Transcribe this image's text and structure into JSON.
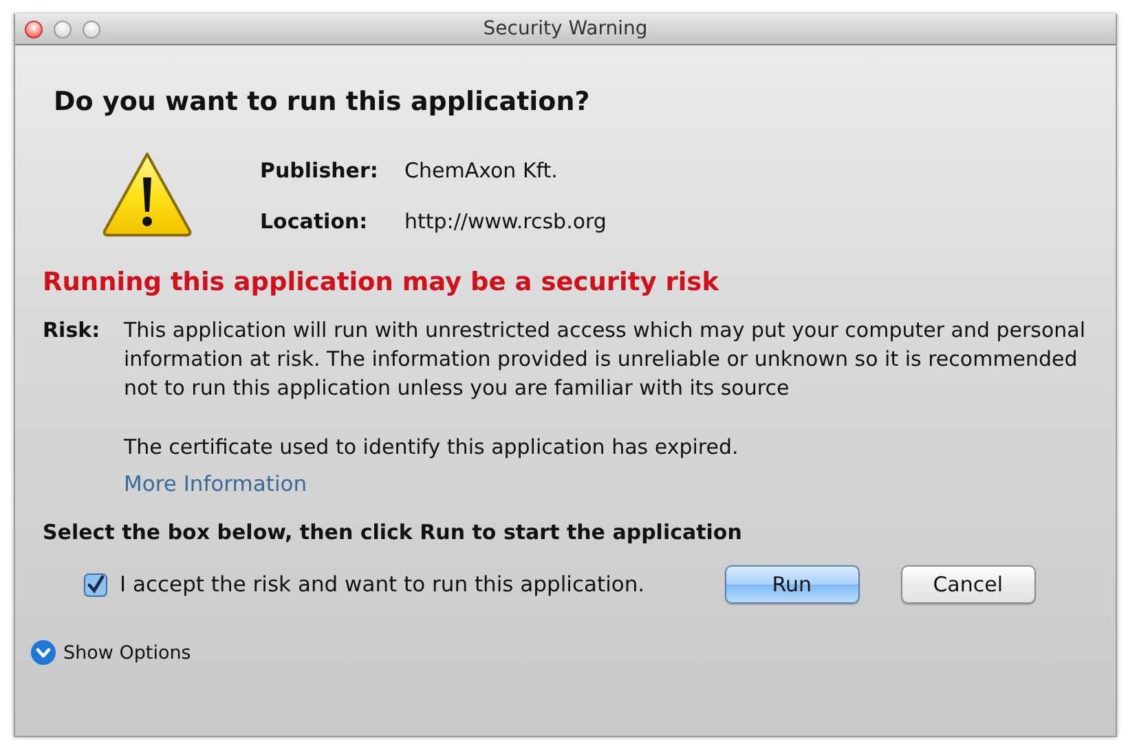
{
  "window": {
    "title": "Security Warning"
  },
  "heading": "Do you want to run this application?",
  "details": [
    {
      "label": "Publisher:",
      "value": "ChemAxon Kft."
    },
    {
      "label": "Location:",
      "value": "http://www.rcsb.org"
    }
  ],
  "risk_heading": "Running this application may be a security risk",
  "risk": {
    "label": "Risk:",
    "paragraphs": [
      "This application will run with unrestricted access which may put your computer and personal information at risk. The information provided is unreliable or unknown so it is recommended not to run this application unless you are familiar with its source",
      "The certificate used to identify this application has expired."
    ]
  },
  "more_info_link": "More Information",
  "instruction": "Select the box below, then click Run to start the application",
  "accept": {
    "label": "I accept the risk and want to run this application.",
    "checked": true
  },
  "buttons": [
    {
      "label": "Run",
      "kind": "default"
    },
    {
      "label": "Cancel",
      "kind": "normal"
    }
  ],
  "show_options": {
    "label": "Show Options",
    "expanded": false
  }
}
